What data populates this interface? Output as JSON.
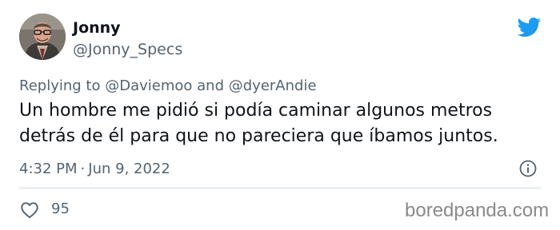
{
  "author": {
    "display_name": "Jonny",
    "handle": "@Jonny_Specs",
    "avatar_icon": "avatar-photo"
  },
  "reply_context": {
    "prefix": "Replying to",
    "mention1": "@Daviemoo",
    "conjunction": "and",
    "mention2": "@dyerAndie"
  },
  "tweet": {
    "text": "Un hombre me pidió si podía caminar algunos metros detrás de él para que no pareciera que íbamos juntos.",
    "time": "4:32 PM",
    "separator": "·",
    "date": "Jun 9, 2022"
  },
  "engagement": {
    "likes": "95"
  },
  "watermark": "boredpanda.com",
  "colors": {
    "brand_twitter": "#1d9bf0",
    "text_primary": "#0f1419",
    "text_secondary": "#536471",
    "divider": "#cfd9de",
    "watermark": "#8a8a8a"
  },
  "icons": {
    "brand": "twitter-bird-icon",
    "info": "info-icon",
    "like": "heart-icon"
  }
}
